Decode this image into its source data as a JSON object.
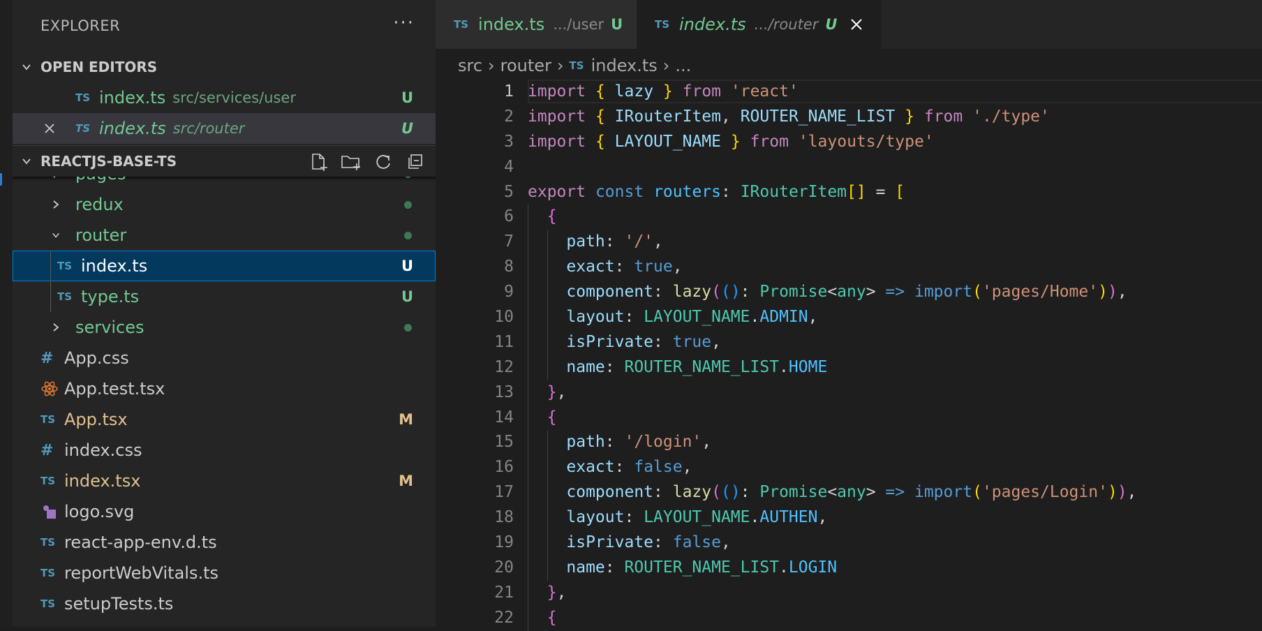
{
  "sidebar": {
    "title": "EXPLORER",
    "more": "···",
    "open_editors": {
      "label": "OPEN EDITORS",
      "items": [
        {
          "icon": "TS",
          "name": "index.ts",
          "path": "src/services/user",
          "status": "U"
        },
        {
          "icon": "TS",
          "name": "index.ts",
          "path": "src/router",
          "status": "U"
        }
      ]
    },
    "project": {
      "label": "REACTJS-BASE-TS",
      "items": [
        {
          "name": "pages"
        },
        {
          "name": "redux"
        },
        {
          "name": "router"
        },
        {
          "icon": "TS",
          "name": "index.ts",
          "status": "U"
        },
        {
          "icon": "TS",
          "name": "type.ts",
          "status": "U"
        },
        {
          "name": "services"
        },
        {
          "icon": "#",
          "name": "App.css"
        },
        {
          "name": "App.test.tsx"
        },
        {
          "icon": "TS",
          "name": "App.tsx",
          "status": "M"
        },
        {
          "icon": "#",
          "name": "index.css"
        },
        {
          "icon": "TS",
          "name": "index.tsx",
          "status": "M"
        },
        {
          "name": "logo.svg"
        },
        {
          "icon": "TS",
          "name": "react-app-env.d.ts"
        },
        {
          "icon": "TS",
          "name": "reportWebVitals.ts"
        },
        {
          "icon": "TS",
          "name": "setupTests.ts"
        }
      ]
    }
  },
  "tabs": [
    {
      "icon": "TS",
      "name": "index.ts",
      "desc": ".../user",
      "status": "U"
    },
    {
      "icon": "TS",
      "name": "index.ts",
      "desc": ".../router",
      "status": "U"
    }
  ],
  "breadcrumb": {
    "parts": [
      "src",
      "router"
    ],
    "icon": "TS",
    "file": "index.ts",
    "more": "..."
  },
  "editor": {
    "line_numbers": [
      "1",
      "2",
      "3",
      "4",
      "5",
      "6",
      "7",
      "8",
      "9",
      "10",
      "11",
      "12",
      "13",
      "14",
      "15",
      "16",
      "17",
      "18",
      "19",
      "20",
      "21",
      "22"
    ]
  },
  "colors": {
    "accent": "#007fd4",
    "untracked": "#73c991",
    "modified": "#e2c08d",
    "ts_icon": "#519aba"
  }
}
